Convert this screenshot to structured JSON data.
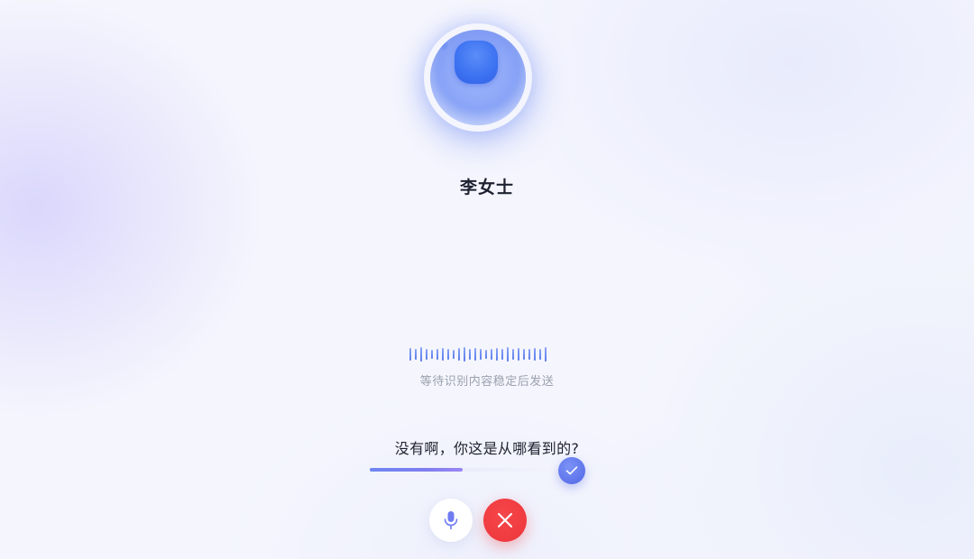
{
  "call": {
    "contact_name": "李女士",
    "avatar_icon": "ai-assistant-orb-icon"
  },
  "voice_input": {
    "status_text": "等待识别内容稳定后发送",
    "waveform_icon": "voice-waveform-icon",
    "transcript": "没有啊，你这是从哪看到的?",
    "progress": 0.48
  },
  "controls": {
    "confirm_icon": "checkmark-icon",
    "mic_icon": "microphone-icon",
    "hangup_icon": "close-icon"
  },
  "colors": {
    "accent": "#5d73ea",
    "hangup": "#ef3a3f",
    "mic_icon": "#6f7cf2"
  }
}
